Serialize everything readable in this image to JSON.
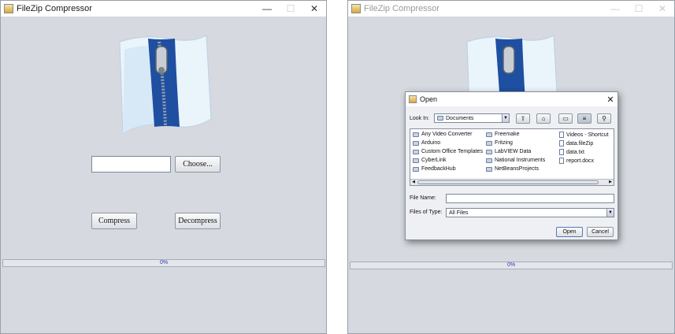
{
  "main_window": {
    "title": "FileZip Compressor",
    "minimize": "—",
    "maximize": "☐",
    "close": "✕",
    "file_path_value": "",
    "choose_label": "Choose...",
    "compress_label": "Compress",
    "decompress_label": "Decompress",
    "progress_text": "0%"
  },
  "second_window": {
    "title": "FileZip Compressor",
    "minimize": "—",
    "maximize": "☐",
    "close": "✕",
    "progress_text": "0%"
  },
  "open_dialog": {
    "title": "Open",
    "close": "✕",
    "look_in_label": "Look In:",
    "look_in_value": "Documents",
    "file_name_label": "File Name:",
    "file_name_value": "",
    "files_of_type_label": "Files of Type:",
    "files_of_type_value": "All Files",
    "open_label": "Open",
    "cancel_label": "Cancel",
    "toolbar_icons": [
      "up-folder-icon",
      "home-icon",
      "new-folder-icon",
      "list-view-icon",
      "details-view-icon"
    ],
    "files": [
      {
        "name": "Any Video Converter",
        "kind": "folder"
      },
      {
        "name": "Arduino",
        "kind": "folder"
      },
      {
        "name": "Custom Office Templates",
        "kind": "folder"
      },
      {
        "name": "CyberLink",
        "kind": "folder"
      },
      {
        "name": "FeedbackHub",
        "kind": "folder"
      },
      {
        "name": "Freemake",
        "kind": "folder"
      },
      {
        "name": "Fritzing",
        "kind": "folder"
      },
      {
        "name": "LabVIEW Data",
        "kind": "folder"
      },
      {
        "name": "National Instruments",
        "kind": "folder"
      },
      {
        "name": "NetBeansProjects",
        "kind": "folder"
      },
      {
        "name": "Videos - Shortcut",
        "kind": "file"
      },
      {
        "name": "data.fileZip",
        "kind": "file"
      },
      {
        "name": "data.txt",
        "kind": "file"
      },
      {
        "name": "report.docx",
        "kind": "file"
      }
    ]
  },
  "colors": {
    "window_bg": "#d6d9df",
    "zipper_blue": "#1f4fa0",
    "progress_text": "#2a3ab8"
  }
}
